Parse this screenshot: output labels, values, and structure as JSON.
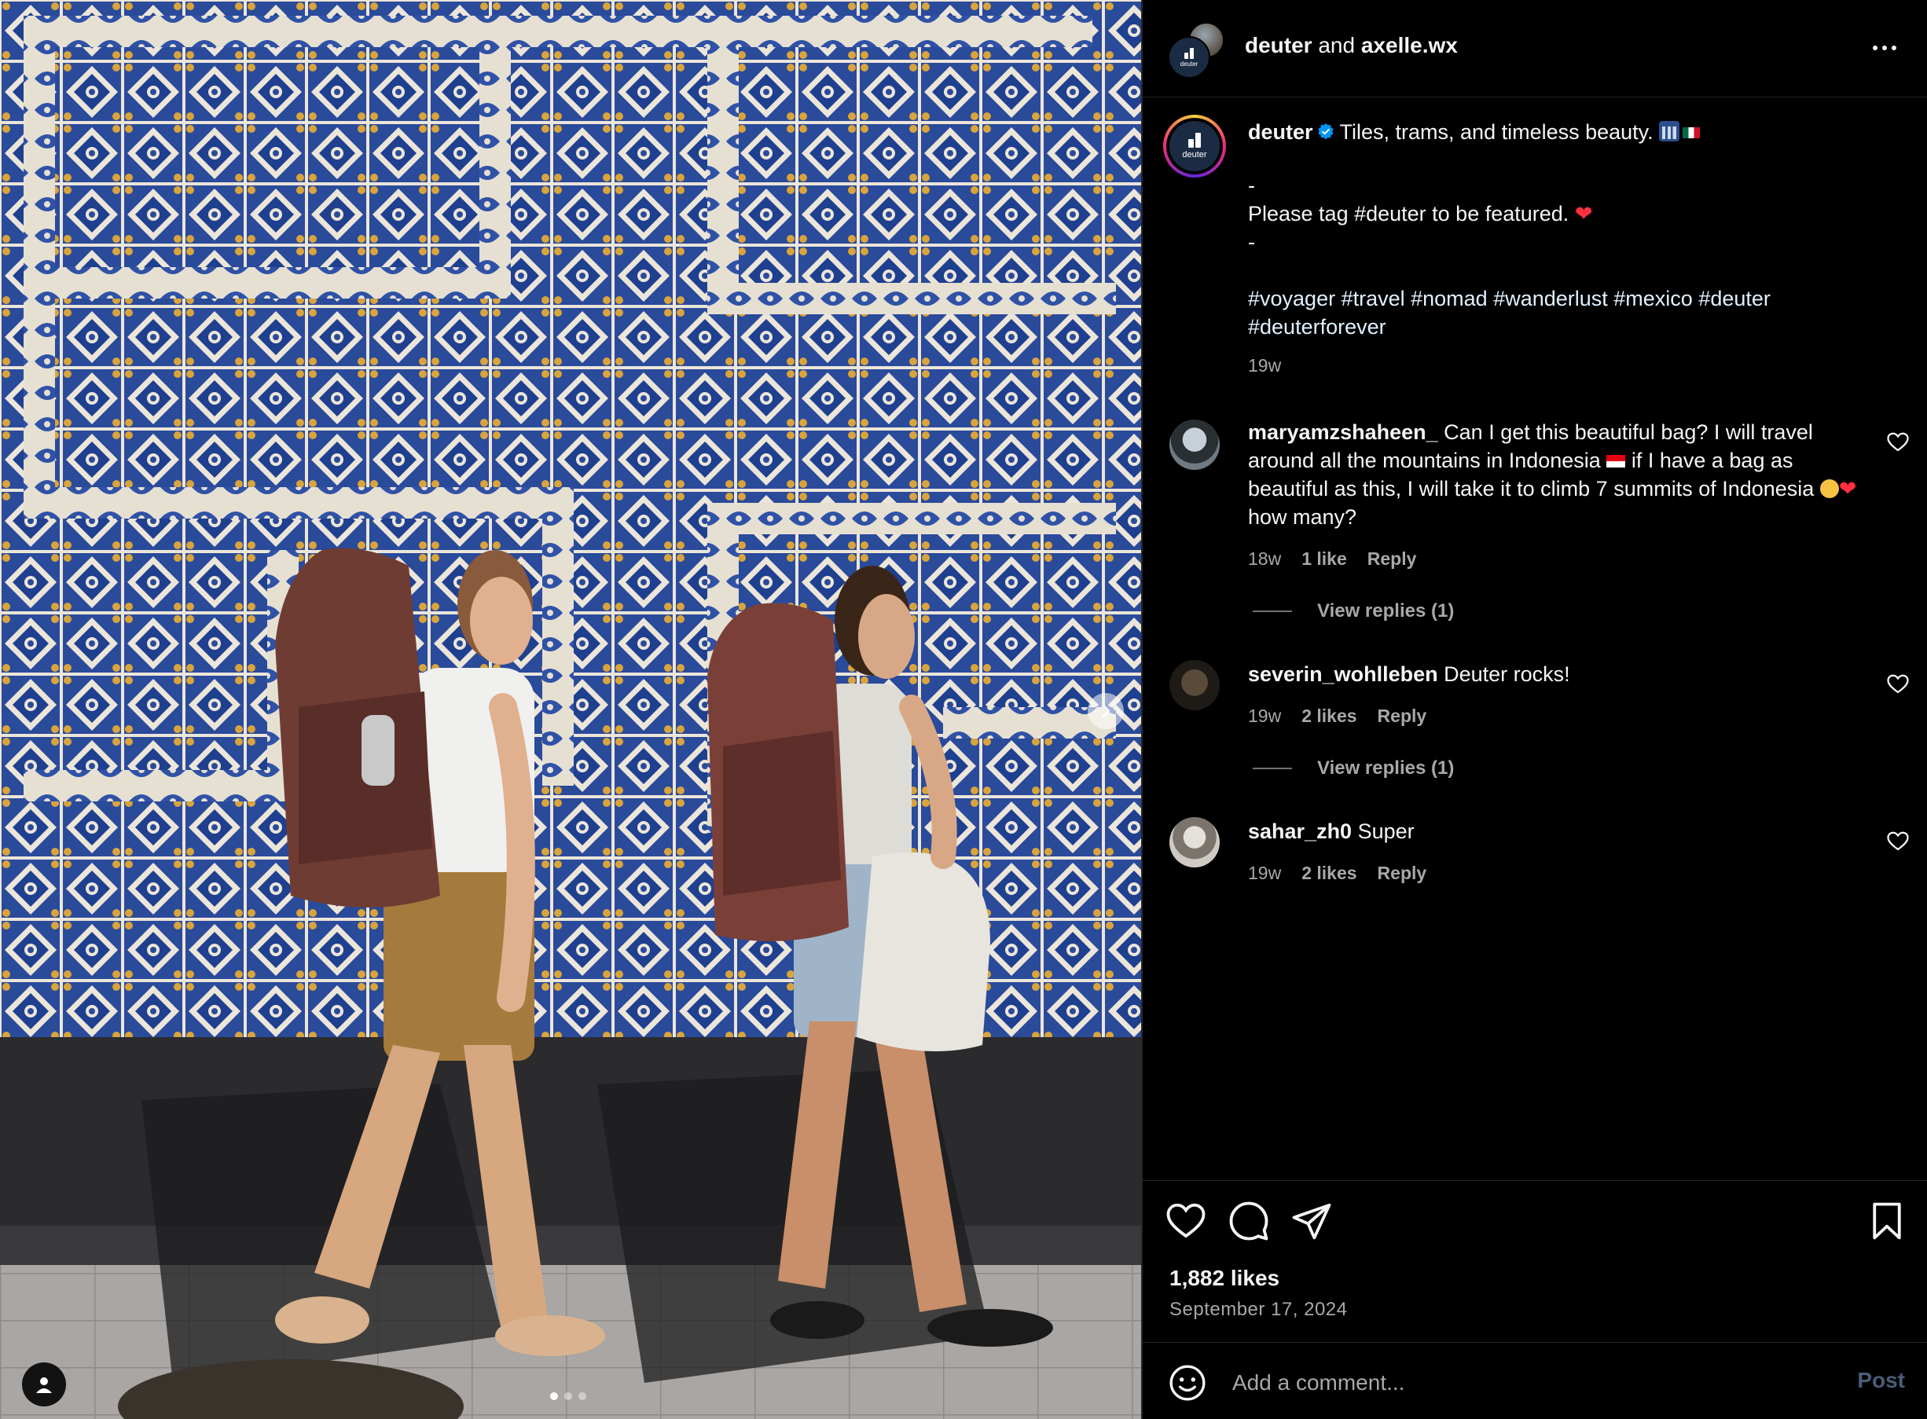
{
  "header": {
    "account": "deuter",
    "joiner": "and",
    "collaborator": "axelle.wx"
  },
  "brand_logo_text": "deuter",
  "caption": {
    "username": "deuter",
    "text": "Tiles, trams, and timeless beauty.",
    "line_dash_1": "-",
    "tag_line": "Please tag #deuter to be featured.",
    "line_dash_2": "-",
    "hashtags_line1": "#voyager #travel #nomad #wanderlust #mexico #deuter",
    "hashtags_line2": "#deuterforever",
    "time": "19w"
  },
  "comments": [
    {
      "username": "maryamzshaheen_",
      "text_part1": "Can I get this beautiful bag? I will travel around all the mountains in Indonesia",
      "text_part2": "if I have a bag as beautiful as this, I will take it to climb 7 summits of Indonesia",
      "text_part3": "how many?",
      "time": "18w",
      "likes": "1 like",
      "reply": "Reply",
      "view_replies": "View replies (1)"
    },
    {
      "username": "severin_wohlleben",
      "text": "Deuter rocks!",
      "time": "19w",
      "likes": "2 likes",
      "reply": "Reply",
      "view_replies": "View replies (1)"
    },
    {
      "username": "sahar_zh0",
      "text": "Super",
      "time": "19w",
      "likes": "2 likes",
      "reply": "Reply"
    }
  ],
  "post": {
    "likes": "1,882 likes",
    "date": "September 17, 2024"
  },
  "comment_box": {
    "placeholder": "Add a comment...",
    "post_label": "Post"
  },
  "icons": {
    "like": "heart-icon",
    "comment": "comment-bubble-icon",
    "share": "paper-plane-icon",
    "save": "bookmark-icon",
    "emoji": "smiley-icon",
    "more": "ellipsis-icon",
    "next": "chevron-right-icon",
    "tag": "user-icon"
  },
  "colors": {
    "background": "#000000",
    "text": "#f5f5f5",
    "secondary_text": "#a8a8a8",
    "verified": "#0095f6",
    "post_button_disabled": "#4a5d7a"
  },
  "carousel": {
    "slide_count": 3,
    "active_index": 0
  }
}
